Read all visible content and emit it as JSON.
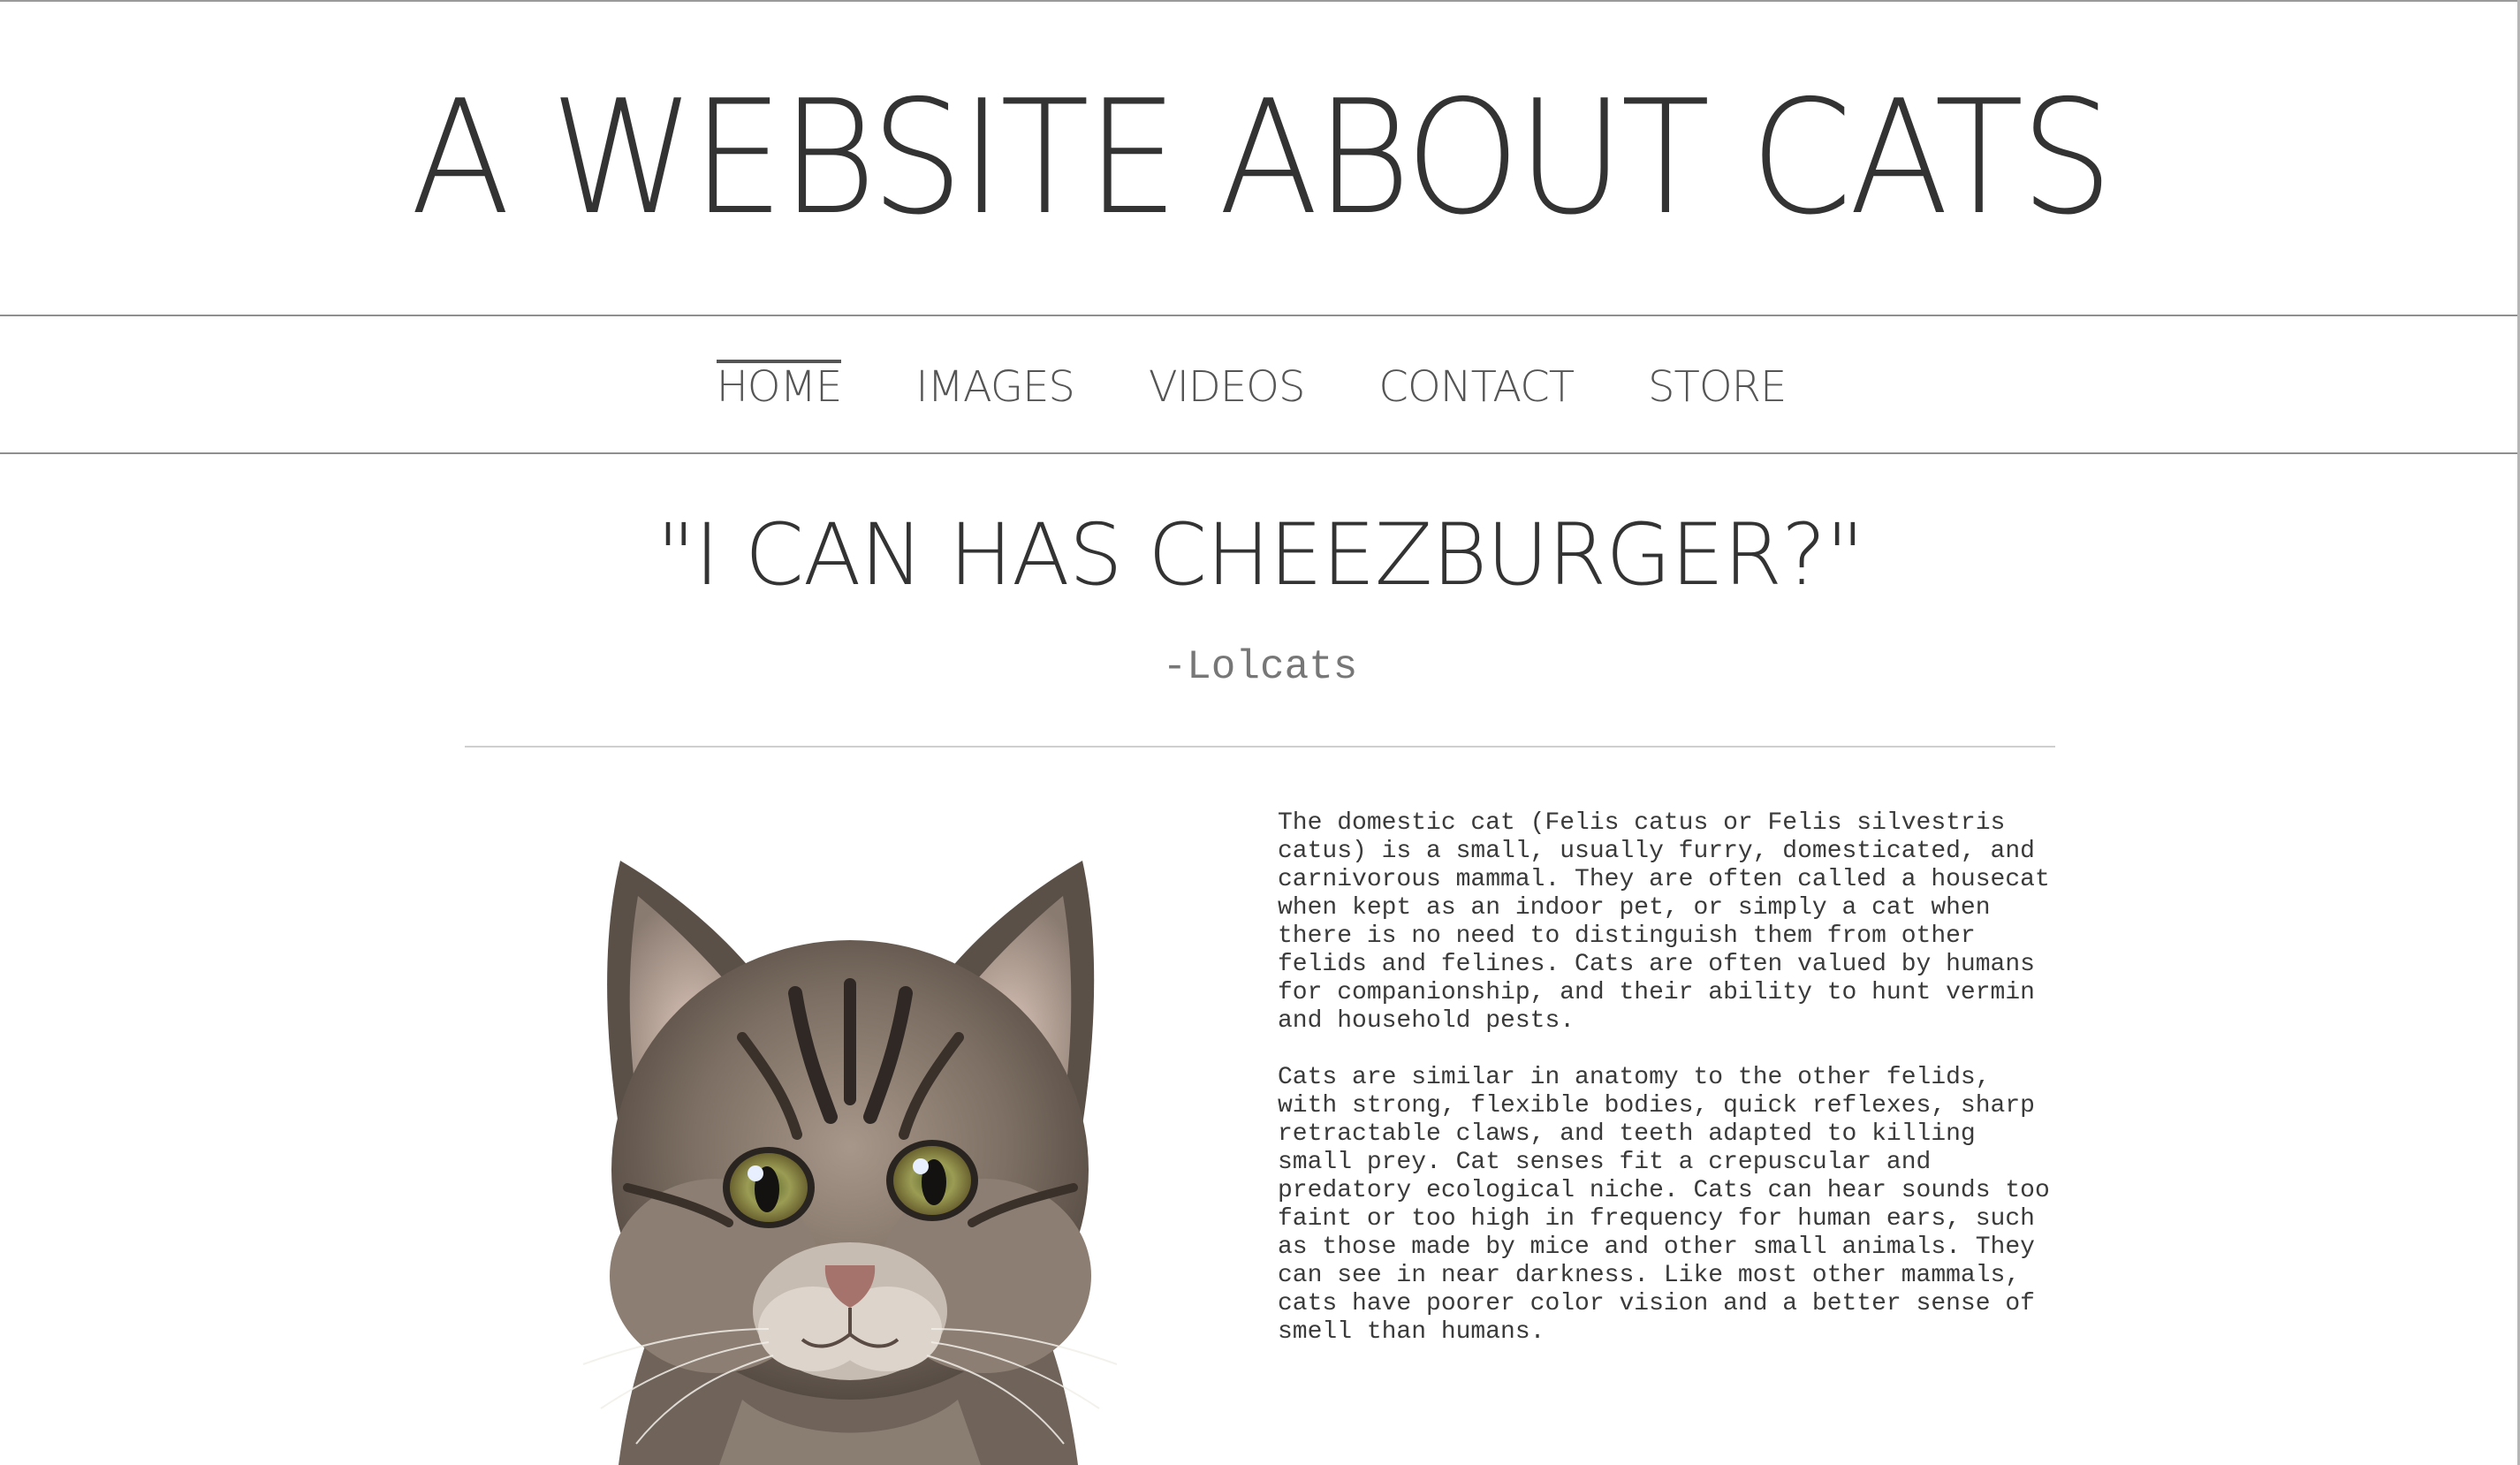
{
  "header": {
    "title": "A WEBSITE ABOUT CATS"
  },
  "nav": {
    "items": [
      {
        "label": "HOME",
        "active": true
      },
      {
        "label": "IMAGES",
        "active": false
      },
      {
        "label": "VIDEOS",
        "active": false
      },
      {
        "label": "CONTACT",
        "active": false
      },
      {
        "label": "STORE",
        "active": false
      }
    ]
  },
  "hero": {
    "quote": "\"I CAN HAS CHEEZBURGER?\"",
    "attribution": "-Lolcats"
  },
  "article": {
    "image_subject": "tabby-kitten-photo",
    "paragraphs": [
      "The domestic cat (Felis catus or Felis silvestris catus) is a small, usually furry, domesticated, and carnivorous mammal. They are often called a housecat when kept as an indoor pet, or simply a cat when there is no need to distinguish them from other felids and felines. Cats are often valued by humans for companionship, and their ability to hunt vermin and household pests.",
      "Cats are similar in anatomy to the other felids, with strong, flexible bodies, quick reflexes, sharp retractable claws, and teeth adapted to killing small prey. Cat senses fit a crepuscular and predatory ecological niche. Cats can hear sounds too faint or too high in frequency for human ears, such as those made by mice and other small animals. They can see in near darkness. Like most other mammals, cats have poorer color vision and a better sense of smell than humans."
    ]
  },
  "colors": {
    "text": "#333333",
    "nav_text": "#555555",
    "rule": "#8f8f8f",
    "divider": "#cfcfcf",
    "background": "#ffffff"
  }
}
